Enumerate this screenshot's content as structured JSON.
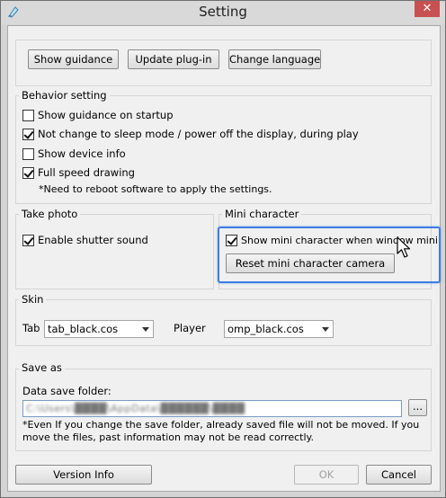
{
  "window": {
    "title": "Setting",
    "close_symbol": "✕"
  },
  "top_buttons": {
    "show_guidance": "Show guidance",
    "update_plugin": "Update plug-in",
    "change_language": "Change language"
  },
  "behavior": {
    "legend": "Behavior setting",
    "show_guidance_startup": {
      "label": "Show guidance on startup",
      "checked": false
    },
    "no_sleep": {
      "label": "Not change to sleep mode /  power off the display, during play",
      "checked": true
    },
    "show_device_info": {
      "label": "Show device info",
      "checked": false
    },
    "full_speed": {
      "label": "Full speed drawing",
      "checked": true
    },
    "note": "*Need to reboot software to apply the settings."
  },
  "take_photo": {
    "legend": "Take photo",
    "shutter_sound": {
      "label": "Enable shutter sound",
      "checked": true
    }
  },
  "mini_character": {
    "legend": "Mini character",
    "show_mini": {
      "label": "Show mini character when window minimiz",
      "checked": true
    },
    "reset_button": "Reset mini character camera"
  },
  "skin": {
    "legend": "Skin",
    "tab_label": "Tab",
    "tab_value": "tab_black.cos",
    "player_label": "Player",
    "player_value": "omp_black.cos"
  },
  "save_as": {
    "legend": "Save as",
    "folder_label": "Data save folder:",
    "folder_value": "C:\\Users\\████\\AppData\\██████\\████",
    "browse_label": "...",
    "note": "*Even If you change the save folder, already saved file will not be moved. If you move the files, past information may not be read correctly."
  },
  "bottom_buttons": {
    "version_info": "Version Info",
    "ok": "OK",
    "cancel": "Cancel"
  },
  "accent_color": "#3d7de3"
}
